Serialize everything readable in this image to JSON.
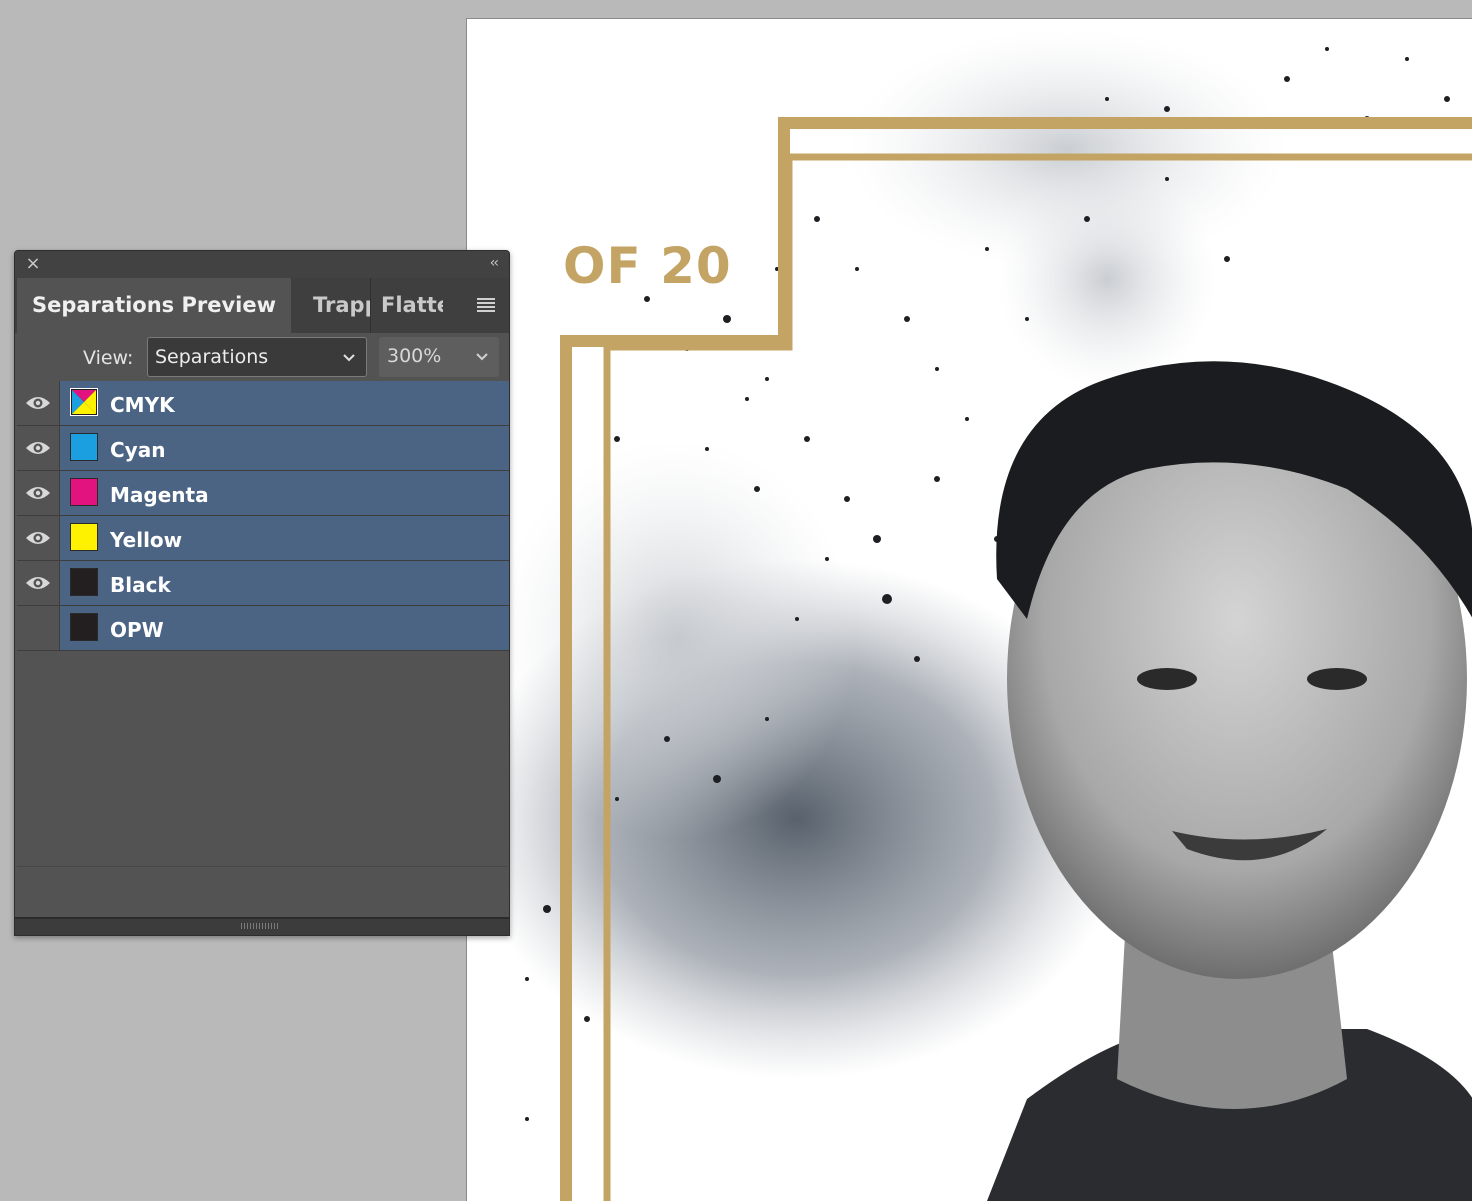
{
  "document": {
    "page_number_text": "OF 20",
    "gold": "#c3a465"
  },
  "panel": {
    "close_icon": "close-icon",
    "collapse_icon": "collapse-icon",
    "tabs": [
      {
        "label": "Separations Preview",
        "active": true
      },
      {
        "label": "Trapping",
        "active": false
      },
      {
        "label": "Flattener Preview",
        "active": false
      }
    ],
    "view_label": "View:",
    "view_value": "Separations",
    "zoom_value": "300%",
    "inks": [
      {
        "name": "CMYK",
        "visible": true,
        "swatch": "cmyk"
      },
      {
        "name": "Cyan",
        "visible": true,
        "swatch": "#1b9fe0"
      },
      {
        "name": "Magenta",
        "visible": true,
        "swatch": "#e2137e"
      },
      {
        "name": "Yellow",
        "visible": true,
        "swatch": "#fff200"
      },
      {
        "name": "Black",
        "visible": true,
        "swatch": "#231f20"
      },
      {
        "name": "OPW",
        "visible": false,
        "swatch": "#231f20"
      }
    ],
    "selection_color": "#4b6484"
  }
}
